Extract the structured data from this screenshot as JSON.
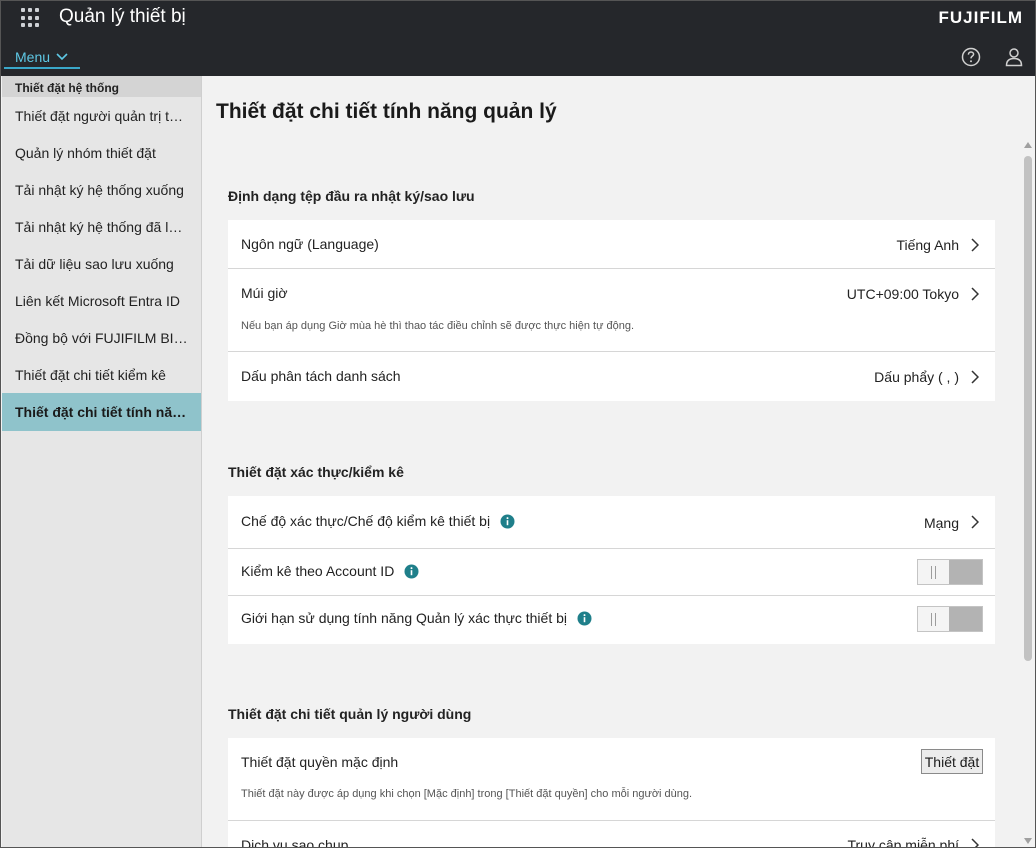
{
  "header": {
    "app_title": "Quản lý thiết bị",
    "brand": "FUJIFILM",
    "menu_label": "Menu"
  },
  "sidebar": {
    "heading": "Thiết đặt hệ thống",
    "items": [
      {
        "label": "Thiết đặt người quản trị tài k..."
      },
      {
        "label": "Quản lý nhóm thiết đặt"
      },
      {
        "label": "Tải nhật ký hệ thống xuống"
      },
      {
        "label": "Tải nhật ký hệ thống đã lưu ..."
      },
      {
        "label": "Tải dữ liệu sao lưu xuống"
      },
      {
        "label": "Liên kết Microsoft Entra ID"
      },
      {
        "label": "Đồng bộ với FUJIFILM BI Di..."
      },
      {
        "label": "Thiết đặt chi tiết kiểm kê"
      },
      {
        "label": "Thiết đặt chi tiết tính năng..."
      }
    ],
    "active_index": 8
  },
  "main": {
    "page_title": "Thiết đặt chi tiết tính năng quản lý",
    "sections": [
      {
        "title": "Định dạng tệp đầu ra nhật ký/sao lưu",
        "rows": [
          {
            "label": "Ngôn ngữ (Language)",
            "value": "Tiếng Anh"
          },
          {
            "label": "Múi giờ",
            "value": "UTC+09:00 Tokyo",
            "description": "Nếu bạn áp dụng Giờ mùa hè thì thao tác điều chỉnh sẽ được thực hiện tự động."
          },
          {
            "label": "Dấu phân tách danh sách",
            "value": "Dấu phẩy ( , )"
          }
        ]
      },
      {
        "title": "Thiết đặt xác thực/kiểm kê",
        "rows": [
          {
            "label": "Chế độ xác thực/Chế độ kiểm kê thiết bị",
            "value": "Mạng"
          },
          {
            "label": "Kiểm kê theo Account ID",
            "toggle": "off"
          },
          {
            "label": "Giới hạn sử dụng tính năng Quản lý xác thực thiết bị",
            "toggle": "off"
          }
        ]
      },
      {
        "title": "Thiết đặt chi tiết quản lý người dùng",
        "rows": [
          {
            "label": "Thiết đặt quyền mặc định",
            "button": "Thiết đặt",
            "description": "Thiết đặt này được áp dụng khi chọn [Mặc định] trong [Thiết đặt quyền] cho mỗi người dùng."
          },
          {
            "label": "Dịch vụ sao chụp",
            "value": "Truy cập miễn phí"
          }
        ]
      }
    ]
  }
}
